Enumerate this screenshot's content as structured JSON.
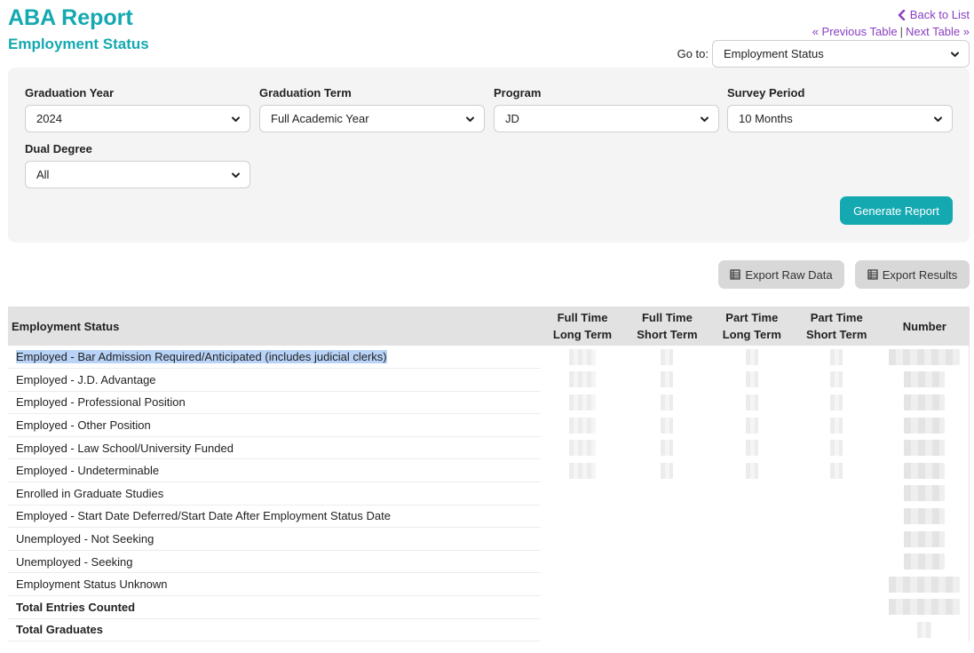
{
  "header": {
    "title": "ABA Report",
    "subtitle": "Employment Status",
    "back_link": "Back to List",
    "prev_link": "« Previous Table",
    "separator": "|",
    "next_link": "Next Table »",
    "goto_label": "Go to:",
    "goto_value": "Employment Status"
  },
  "filters": {
    "graduation_year": {
      "label": "Graduation Year",
      "value": "2024"
    },
    "graduation_term": {
      "label": "Graduation Term",
      "value": "Full Academic Year"
    },
    "program": {
      "label": "Program",
      "value": "JD"
    },
    "survey_period": {
      "label": "Survey Period",
      "value": "10 Months"
    },
    "dual_degree": {
      "label": "Dual Degree",
      "value": "All"
    },
    "generate_label": "Generate Report"
  },
  "exports": {
    "raw_label": "Export Raw Data",
    "results_label": "Export Results"
  },
  "table": {
    "columns": {
      "status": "Employment Status",
      "ftlt_1": "Full Time",
      "ftlt_2": "Long Term",
      "ftst_1": "Full Time",
      "ftst_2": "Short Term",
      "ptlt_1": "Part Time",
      "ptlt_2": "Long Term",
      "ptst_1": "Part Time",
      "ptst_2": "Short Term",
      "number": "Number"
    },
    "rows": [
      "Employed - Bar Admission Required/Anticipated (includes judicial clerks)",
      "Employed - J.D. Advantage",
      "Employed - Professional Position",
      "Employed - Other Position",
      "Employed - Law School/University Funded",
      "Employed - Undeterminable",
      "Enrolled in Graduate Studies",
      "Employed - Start Date Deferred/Start Date After Employment Status Date",
      "Unemployed - Not Seeking",
      "Unemployed - Seeking",
      "Employment Status Unknown",
      "Total Entries Counted",
      "Total Graduates"
    ]
  },
  "colors": {
    "accent": "#14a9b1",
    "link": "#8a3fc2",
    "selection": "#b8d3f7"
  }
}
